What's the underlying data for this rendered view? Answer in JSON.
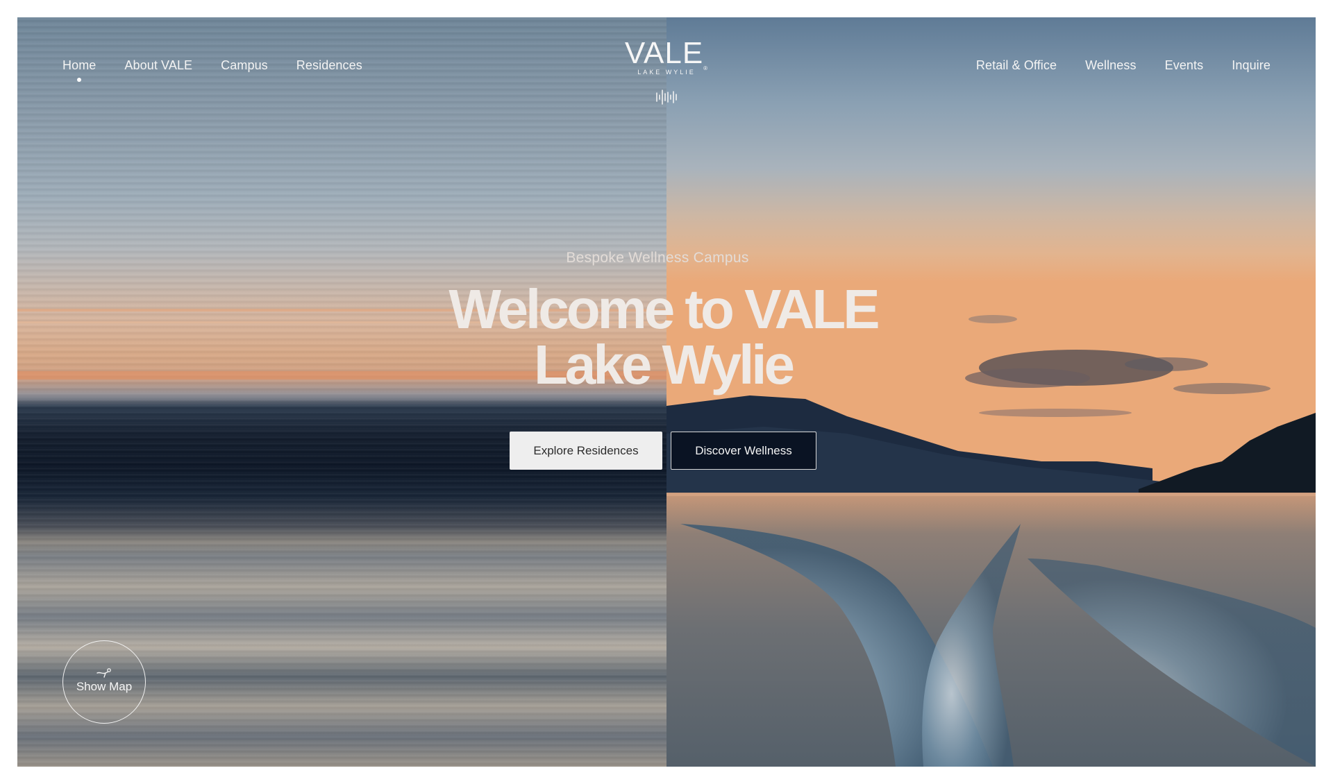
{
  "nav": {
    "left": [
      {
        "label": "Home",
        "active": true
      },
      {
        "label": "About VALE"
      },
      {
        "label": "Campus"
      },
      {
        "label": "Residences"
      }
    ],
    "right": [
      {
        "label": "Retail & Office"
      },
      {
        "label": "Wellness"
      },
      {
        "label": "Events"
      },
      {
        "label": "Inquire"
      }
    ]
  },
  "logo": {
    "name": "VALE",
    "registered": "®",
    "tagline": "LAKE WYLIE"
  },
  "icons": {
    "sound": "sound-wave-icon",
    "map": "map-pin-icon"
  },
  "hero": {
    "eyebrow": "Bespoke Wellness Campus",
    "title_line1": "Welcome to VALE",
    "title_line2": "Lake Wylie",
    "primary_cta": "Explore Residences",
    "secondary_cta": "Discover Wellness"
  },
  "map_button": {
    "label": "Show Map"
  },
  "colors": {
    "text": "#f4f4f4",
    "primary_button_bg": "#eeeeee",
    "secondary_button_bg": "#0a1222"
  }
}
